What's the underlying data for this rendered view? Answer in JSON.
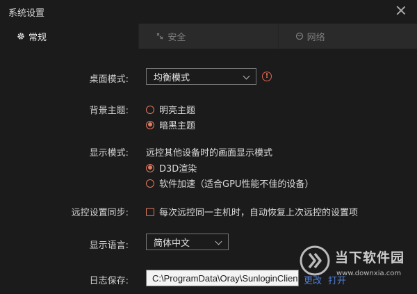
{
  "window": {
    "title": "系统设置"
  },
  "tabs": [
    {
      "label": "常规",
      "icon": "gear-icon",
      "active": true
    },
    {
      "label": "安全",
      "icon": "shield-icon",
      "active": false
    },
    {
      "label": "网络",
      "icon": "globe-icon",
      "active": false
    }
  ],
  "desktop_mode": {
    "label": "桌面模式:",
    "value": "均衡模式",
    "warning_icon": "alert-icon"
  },
  "background_theme": {
    "label": "背景主题:",
    "options": [
      {
        "label": "明亮主题",
        "selected": false
      },
      {
        "label": "暗黑主题",
        "selected": true
      }
    ]
  },
  "display_mode": {
    "label": "显示模式:",
    "description": "远控其他设备时的画面显示模式",
    "options": [
      {
        "label": "D3D渲染",
        "selected": true
      },
      {
        "label": "软件加速（适合GPU性能不佳的设备）",
        "selected": false
      }
    ]
  },
  "remote_sync": {
    "label": "远控设置同步:",
    "checkbox_label": "每次远控同一主机时，自动恢复上次远控的设置项",
    "checked": false
  },
  "language": {
    "label": "显示语言:",
    "value": "简体中文"
  },
  "log_save": {
    "label": "日志保存:",
    "path": "C:\\ProgramData\\Oray\\SunloginClient",
    "change_label": "更改",
    "open_label": "打开"
  },
  "watermark": {
    "name": "当下软件园",
    "url": "www.downxia.com"
  },
  "colors": {
    "accent": "#e47a5f",
    "warning": "#e5674e",
    "link": "#4f7fd8",
    "background": "#1b1b1b",
    "tab_bar": "#2a2a2a"
  }
}
